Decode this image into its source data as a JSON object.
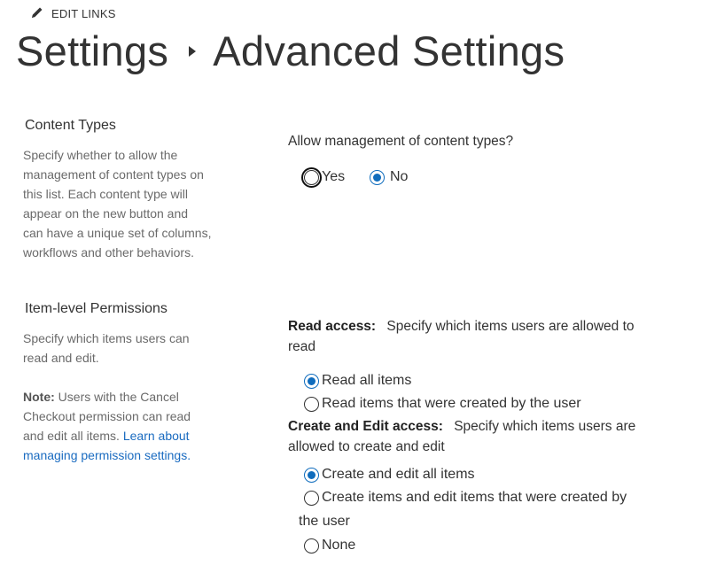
{
  "toolbar": {
    "edit_links_label": "EDIT LINKS",
    "edit_icon": "pencil-icon"
  },
  "breadcrumb": {
    "parent": "Settings",
    "separator_icon": "triangle-right-icon",
    "current": "Advanced Settings"
  },
  "content_types": {
    "heading": "Content Types",
    "description": [
      "Specify whether to allow the",
      "management of content types on",
      "this list. Each content type will",
      "appear on the new button and",
      "can have a unique set of columns,",
      "workflows and other behaviors."
    ],
    "question": "Allow management of content types?",
    "options": [
      {
        "label": "Yes",
        "checked": false,
        "focused": true
      },
      {
        "label": "No",
        "checked": true,
        "focused": false
      }
    ]
  },
  "item_permissions": {
    "heading": "Item-level Permissions",
    "description": [
      "Specify which items users can",
      "read and edit."
    ],
    "note_label": "Note:",
    "note_lines": [
      " Users with the Cancel",
      "Checkout permission can read",
      "and edit all items. "
    ],
    "learn_link_part1": "Learn about",
    "learn_link_part2": "managing permission settings.",
    "read_access": {
      "label": "Read access:",
      "description_line1": "Specify which items users are allowed to",
      "description_line2": "read",
      "options": [
        {
          "label": "Read all items",
          "checked": true
        },
        {
          "label": "Read items that were created by the user",
          "checked": false
        }
      ]
    },
    "edit_access": {
      "label": "Create and Edit access:",
      "description_line1": "Specify which items users are",
      "description_line2": "allowed to create and edit",
      "options": [
        {
          "label": "Create and edit all items",
          "checked": true
        },
        {
          "label": "Create items and edit items that were created by",
          "label_continued": "the user",
          "checked": false
        },
        {
          "label": "None",
          "checked": false
        }
      ]
    }
  },
  "colors": {
    "accent": "#0f6cbd",
    "link": "#1a6bc0",
    "text": "#333333",
    "muted": "#6a6a6a"
  }
}
